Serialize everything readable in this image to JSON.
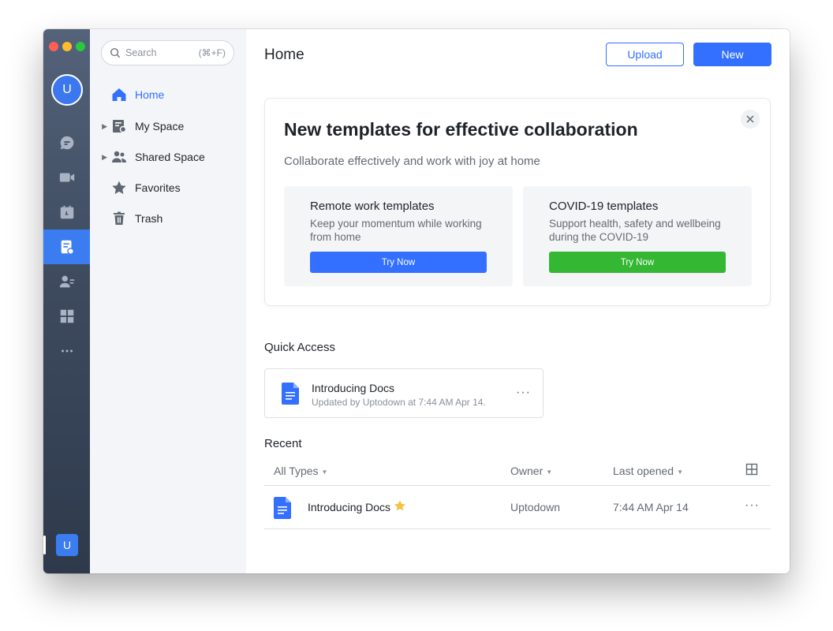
{
  "window": {
    "traffic_colors": [
      "#ff5f57",
      "#febc2e",
      "#28c840"
    ]
  },
  "rail": {
    "user_initial": "U",
    "items": [
      {
        "icon": "chat-icon"
      },
      {
        "icon": "video-icon"
      },
      {
        "icon": "calendar-icon"
      },
      {
        "icon": "docs-icon",
        "active": true
      },
      {
        "icon": "contacts-icon"
      },
      {
        "icon": "workplace-icon"
      },
      {
        "icon": "more-icon"
      }
    ],
    "bottom_initial": "U"
  },
  "nav": {
    "search": {
      "placeholder": "Search",
      "shortcut": "(⌘+F)"
    },
    "items": [
      {
        "label": "Home",
        "icon": "home-icon",
        "active": true
      },
      {
        "label": "My Space",
        "icon": "my-space-icon",
        "expandable": true
      },
      {
        "label": "Shared Space",
        "icon": "shared-space-icon",
        "expandable": true
      },
      {
        "label": "Favorites",
        "icon": "star-icon"
      },
      {
        "label": "Trash",
        "icon": "trash-icon"
      }
    ]
  },
  "header": {
    "title": "Home",
    "upload_label": "Upload",
    "new_label": "New"
  },
  "banner": {
    "title": "New templates for effective collaboration",
    "subtitle": "Collaborate effectively and work with joy at home",
    "cards": [
      {
        "title": "Remote work templates",
        "description": "Keep your momentum while working from home",
        "button": "Try Now",
        "color": "#3370ff"
      },
      {
        "title": "COVID-19 templates",
        "description": "Support health, safety and wellbeing during the COVID-19",
        "button": "Try Now",
        "color": "#34b733"
      }
    ]
  },
  "quick_access": {
    "title": "Quick Access",
    "items": [
      {
        "name": "Introducing Docs",
        "meta": "Updated by Uptodown at 7:44 AM Apr 14."
      }
    ]
  },
  "recent": {
    "title": "Recent",
    "columns": {
      "type": "All Types",
      "owner": "Owner",
      "last_opened": "Last opened"
    },
    "rows": [
      {
        "name": "Introducing Docs",
        "starred": true,
        "owner": "Uptodown",
        "last_opened": "7:44 AM Apr 14"
      }
    ]
  },
  "colors": {
    "accent": "#3370ff",
    "green": "#34b733",
    "star": "#f5c242"
  }
}
